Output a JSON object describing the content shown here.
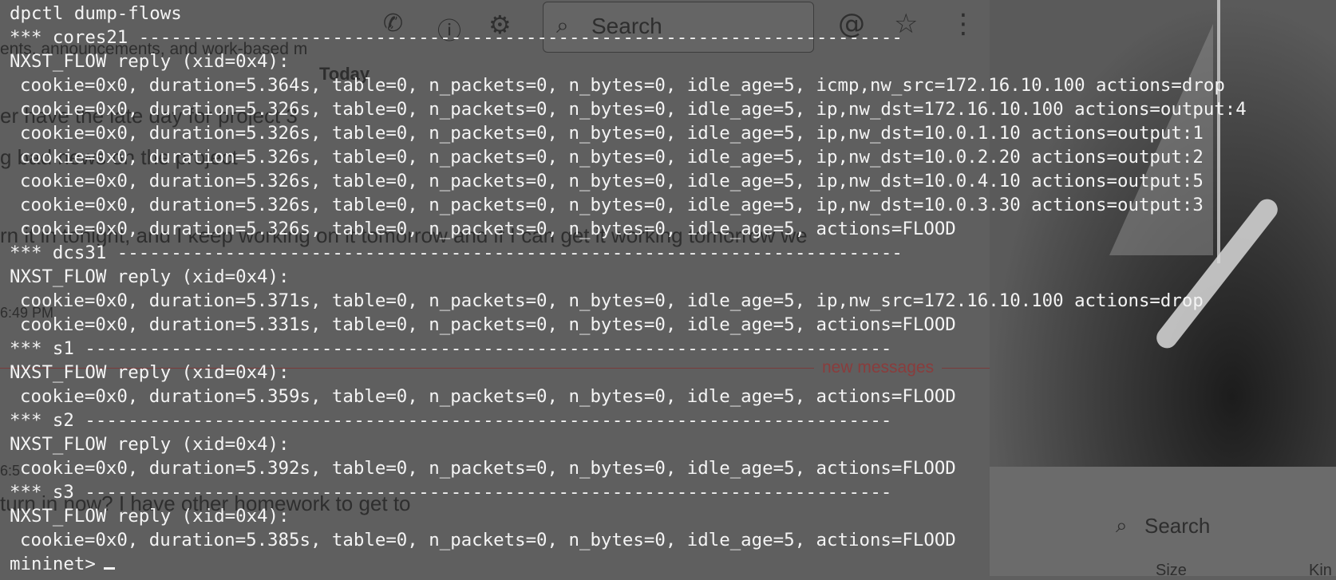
{
  "background": {
    "toolbar": {
      "search_placeholder": "Search",
      "icons": [
        "phone-icon",
        "info-icon",
        "gear-icon",
        "search-icon",
        "at-icon",
        "star-icon",
        "more-icon"
      ]
    },
    "chat_fragments": [
      "ents, announcements, and work-based m",
      "Today",
      "er have the late day for project 3",
      "g bad news on the project",
      "rn it in tonight, and I keep working on it tomorrow and if I can get it working tomorrow we",
      "6:49 PM",
      "new messages",
      "6:5",
      "turn in now? I have other homework to get to"
    ],
    "side_panel": {
      "search_placeholder": "Search",
      "columns": [
        "Size",
        "Kin"
      ]
    }
  },
  "terminal": {
    "lines": [
      {
        "text": "dpctl dump-flows",
        "indent": false
      },
      {
        "text": "*** cores21 -----------------------------------------------------------------------",
        "indent": false
      },
      {
        "text": "NXST_FLOW reply (xid=0x4):",
        "indent": false
      },
      {
        "text": "cookie=0x0, duration=5.364s, table=0, n_packets=0, n_bytes=0, idle_age=5, icmp,nw_src=172.16.10.100 actions=drop",
        "indent": true
      },
      {
        "text": "cookie=0x0, duration=5.326s, table=0, n_packets=0, n_bytes=0, idle_age=5, ip,nw_dst=172.16.10.100 actions=output:4",
        "indent": true
      },
      {
        "text": "cookie=0x0, duration=5.326s, table=0, n_packets=0, n_bytes=0, idle_age=5, ip,nw_dst=10.0.1.10 actions=output:1",
        "indent": true
      },
      {
        "text": "cookie=0x0, duration=5.326s, table=0, n_packets=0, n_bytes=0, idle_age=5, ip,nw_dst=10.0.2.20 actions=output:2",
        "indent": true
      },
      {
        "text": "cookie=0x0, duration=5.326s, table=0, n_packets=0, n_bytes=0, idle_age=5, ip,nw_dst=10.0.4.10 actions=output:5",
        "indent": true
      },
      {
        "text": "cookie=0x0, duration=5.326s, table=0, n_packets=0, n_bytes=0, idle_age=5, ip,nw_dst=10.0.3.30 actions=output:3",
        "indent": true
      },
      {
        "text": "cookie=0x0, duration=5.326s, table=0, n_packets=0, n_bytes=0, idle_age=5, actions=FLOOD",
        "indent": true
      },
      {
        "text": "*** dcs31 -------------------------------------------------------------------------",
        "indent": false
      },
      {
        "text": "NXST_FLOW reply (xid=0x4):",
        "indent": false
      },
      {
        "text": "cookie=0x0, duration=5.371s, table=0, n_packets=0, n_bytes=0, idle_age=5, ip,nw_src=172.16.10.100 actions=drop",
        "indent": true
      },
      {
        "text": "cookie=0x0, duration=5.331s, table=0, n_packets=0, n_bytes=0, idle_age=5, actions=FLOOD",
        "indent": true
      },
      {
        "text": "*** s1 ---------------------------------------------------------------------------",
        "indent": false
      },
      {
        "text": "NXST_FLOW reply (xid=0x4):",
        "indent": false
      },
      {
        "text": "cookie=0x0, duration=5.359s, table=0, n_packets=0, n_bytes=0, idle_age=5, actions=FLOOD",
        "indent": true
      },
      {
        "text": "*** s2 ---------------------------------------------------------------------------",
        "indent": false
      },
      {
        "text": "NXST_FLOW reply (xid=0x4):",
        "indent": false
      },
      {
        "text": "cookie=0x0, duration=5.392s, table=0, n_packets=0, n_bytes=0, idle_age=5, actions=FLOOD",
        "indent": true
      },
      {
        "text": "*** s3 ---------------------------------------------------------------------------",
        "indent": false
      },
      {
        "text": "NXST_FLOW reply (xid=0x4):",
        "indent": false
      },
      {
        "text": "cookie=0x0, duration=5.385s, table=0, n_packets=0, n_bytes=0, idle_age=5, actions=FLOOD",
        "indent": true
      }
    ],
    "prompt": "mininet>"
  }
}
